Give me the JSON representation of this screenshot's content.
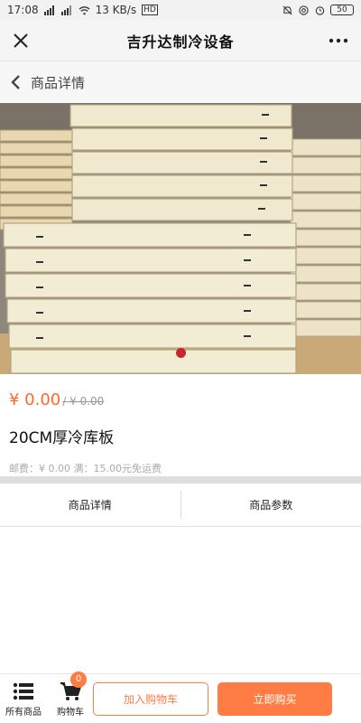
{
  "status_bar": {
    "time": "17:08",
    "network_speed": "13 KB/s",
    "network_badge": "HD",
    "battery": "50"
  },
  "header": {
    "title": "吉升达制冷设备",
    "close_icon": "close-icon",
    "more_icon": "more-icon"
  },
  "sub_header": {
    "title": "商品详情",
    "back_icon": "chevron-left-icon"
  },
  "product": {
    "image_description": "stack of cold storage insulation panels",
    "carousel_active_index": 0,
    "price": "¥ 0.00",
    "old_price": "/ ¥ 0.00",
    "name": "20CM厚冷库板",
    "shipping": "邮费：¥ 0.00 满：15.00元免运费"
  },
  "tabs": [
    {
      "label": "商品详情"
    },
    {
      "label": "商品参数"
    }
  ],
  "bottom_bar": {
    "all_products_label": "所有商品",
    "cart_label": "购物车",
    "cart_count": "0",
    "add_to_cart_label": "加入购物车",
    "buy_now_label": "立即购买"
  },
  "colors": {
    "accent": "#ff7d44",
    "price": "#ff6a2a",
    "carousel_dot": "#c62828"
  }
}
